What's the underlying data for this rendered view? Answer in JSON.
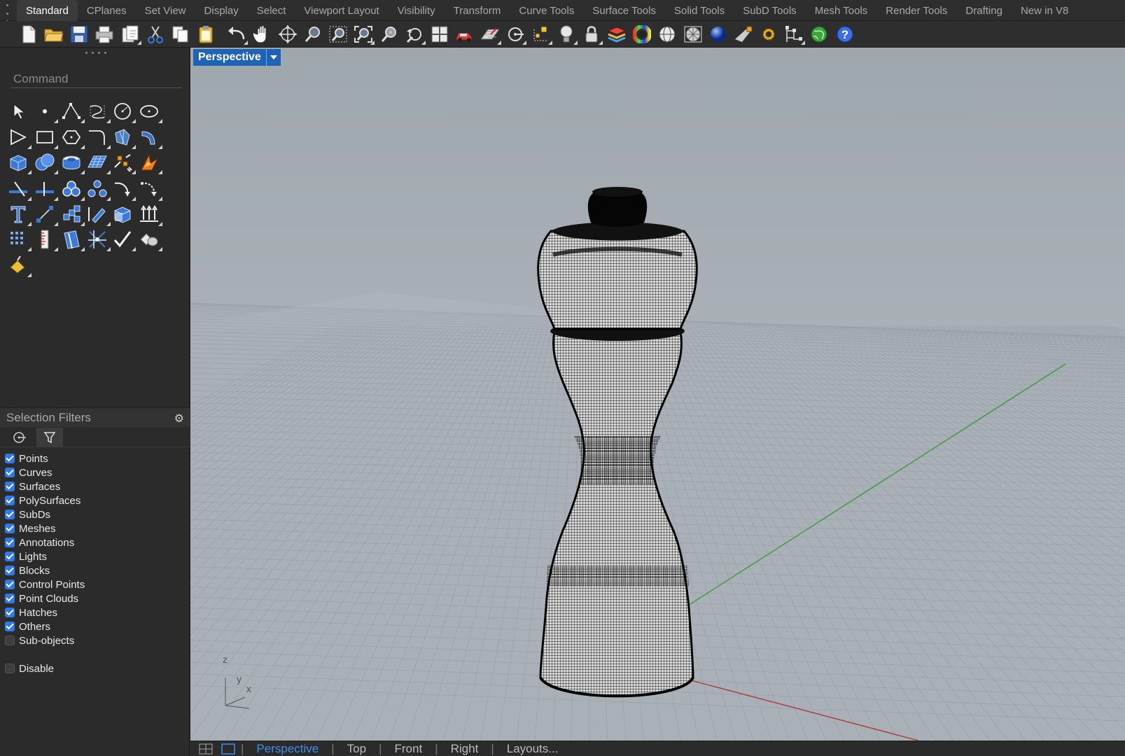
{
  "tabs": [
    "Standard",
    "CPlanes",
    "Set View",
    "Display",
    "Select",
    "Viewport Layout",
    "Visibility",
    "Transform",
    "Curve Tools",
    "Surface Tools",
    "Solid Tools",
    "SubD Tools",
    "Mesh Tools",
    "Render Tools",
    "Drafting",
    "New in V8"
  ],
  "active_tab": "Standard",
  "command": {
    "placeholder": "Command"
  },
  "selection_filters": {
    "title": "Selection Filters",
    "items": [
      {
        "label": "Points",
        "checked": true
      },
      {
        "label": "Curves",
        "checked": true
      },
      {
        "label": "Surfaces",
        "checked": true
      },
      {
        "label": "PolySurfaces",
        "checked": true
      },
      {
        "label": "SubDs",
        "checked": true
      },
      {
        "label": "Meshes",
        "checked": true
      },
      {
        "label": "Annotations",
        "checked": true
      },
      {
        "label": "Lights",
        "checked": true
      },
      {
        "label": "Blocks",
        "checked": true
      },
      {
        "label": "Control Points",
        "checked": true
      },
      {
        "label": "Point Clouds",
        "checked": true
      },
      {
        "label": "Hatches",
        "checked": true
      },
      {
        "label": "Others",
        "checked": true
      },
      {
        "label": "Sub-objects",
        "checked": false
      }
    ],
    "disable": {
      "label": "Disable",
      "checked": false
    }
  },
  "viewport": {
    "name": "Perspective",
    "axis_labels": {
      "z": "z",
      "y": "y",
      "x": "x"
    }
  },
  "bottom_tabs": [
    "Perspective",
    "Top",
    "Front",
    "Right",
    "Layouts..."
  ],
  "active_bottom_tab": "Perspective",
  "colors": {
    "accent": "#1f63b4",
    "active_tab_text": "#3d8ef0",
    "checkbox": "#2f7ae6",
    "x_axis": "#b23a3a",
    "y_axis": "#3f9a3f"
  }
}
